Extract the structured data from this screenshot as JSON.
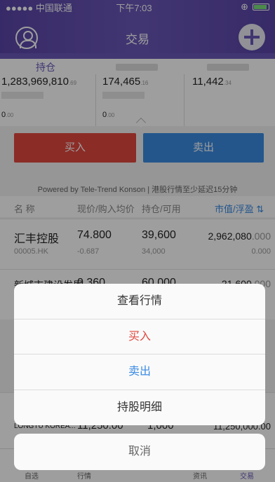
{
  "status": {
    "carrier": "●●●●● 中国联通",
    "time": "下午7:03"
  },
  "header": {
    "title": "交易"
  },
  "account_tabs": [
    {
      "label": "持仓",
      "active": true
    }
  ],
  "summary": {
    "total": "1,283,969,810",
    "total_dec": ".69",
    "col2": "174,465",
    "col2_dec": ".16",
    "col3": "11,442",
    "col3_dec": ".34",
    "zero1": "0",
    "zero1_dec": ".00",
    "zero2": "0",
    "zero2_dec": ".00"
  },
  "actions": {
    "buy": "买入",
    "sell": "卖出"
  },
  "powered": "Powered by Tele-Trend Konson | 港股行情至少延迟15分钟",
  "holdings_header": {
    "name": "名 称",
    "price": "现价/购入均价",
    "position": "持仓/可用",
    "value": "市值/浮盈 ⇅"
  },
  "holdings": [
    {
      "name": "汇丰控股",
      "code": "00005.HK",
      "price": "74.800",
      "avg": "-0.687",
      "qty": "39,600",
      "avail": "34,000",
      "value": "2,962,080",
      "value_dec": ".000",
      "pl": "0",
      "pl_dec": ".000"
    },
    {
      "name": "新城市建设发展",
      "price": "0.360",
      "qty": "60,000",
      "value": "21,600",
      "value_dec": ".000"
    },
    {
      "name": "LONGTU KOREA...",
      "price": "11,250.00",
      "qty": "1,000",
      "value": "11,250,000",
      "value_dec": ".00"
    }
  ],
  "sheet": {
    "view": "查看行情",
    "buy": "买入",
    "sell": "卖出",
    "detail": "持股明细",
    "cancel": "取消"
  },
  "sheet_colors": {
    "buy": "#e2473f",
    "sell": "#3a8be3",
    "normal": "#333333"
  },
  "tabbar": [
    {
      "label": "自选"
    },
    {
      "label": "行情"
    },
    {
      "label": "资讯"
    },
    {
      "label": "交易",
      "active": true
    }
  ]
}
